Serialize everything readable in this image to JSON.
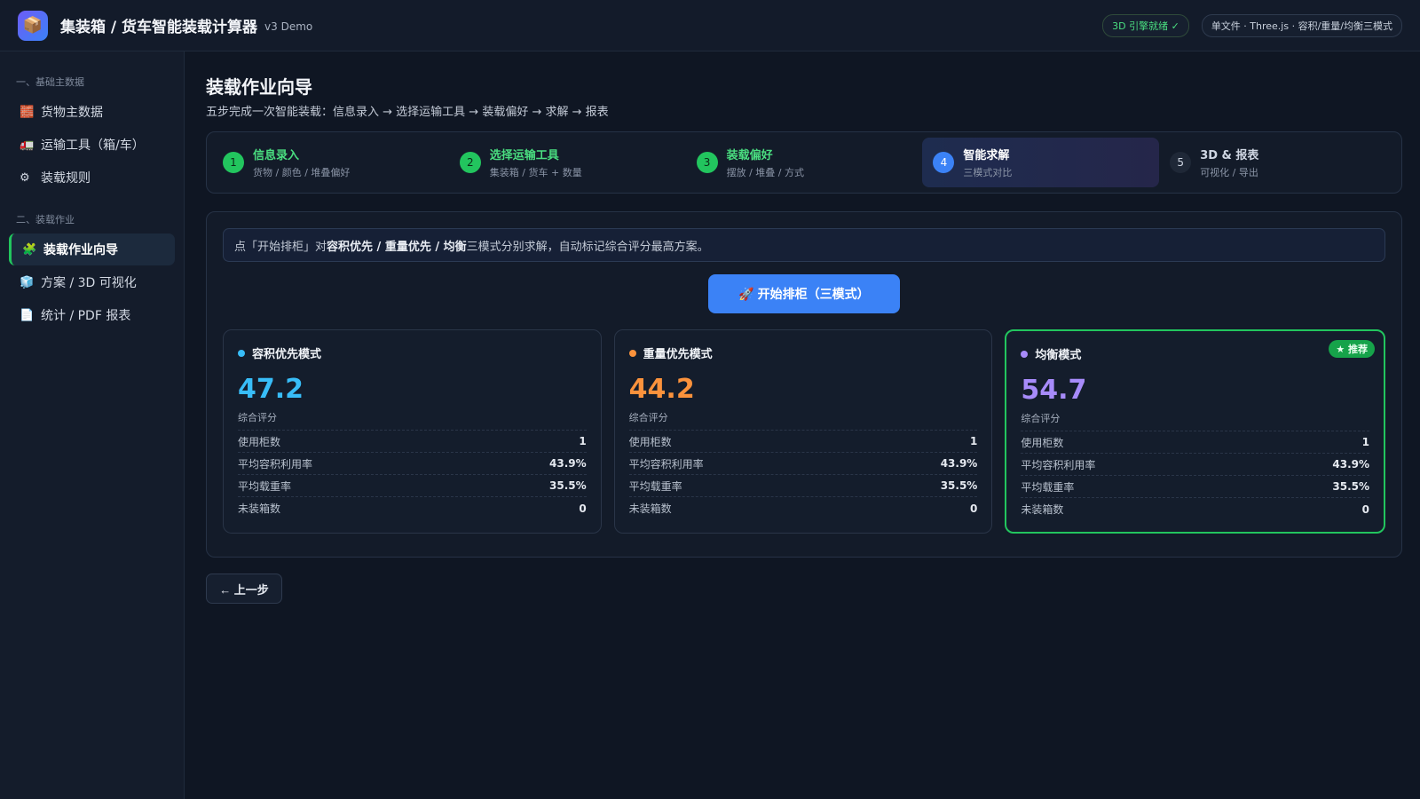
{
  "header": {
    "logo_icon": "package-icon",
    "title": "集装箱 / 货车智能装载计算器",
    "version": "v3 Demo",
    "engine_status": "3D 引擎就绪 ✓",
    "info": "单文件 · Three.js · 容积/重量/均衡三模式"
  },
  "sidebar": {
    "sections": [
      {
        "title": "一、基础主数据",
        "items": [
          {
            "label": "货物主数据",
            "icon": "bricks-icon",
            "glyph": "🧱"
          },
          {
            "label": "运输工具（箱/车）",
            "icon": "truck-icon",
            "glyph": "🚛"
          },
          {
            "label": "装载规则",
            "icon": "gear-icon",
            "glyph": "⚙"
          }
        ]
      },
      {
        "title": "二、装载作业",
        "items": [
          {
            "label": "装载作业向导",
            "icon": "puzzle-icon",
            "glyph": "🧩",
            "active": true
          },
          {
            "label": "方案 / 3D 可视化",
            "icon": "cube-icon",
            "glyph": "🧊"
          },
          {
            "label": "统计 / PDF 报表",
            "icon": "document-icon",
            "glyph": "📄"
          }
        ]
      }
    ]
  },
  "main": {
    "title": "装载作业向导",
    "subtitle": "五步完成一次智能装载：信息录入 → 选择运输工具 → 装载偏好 → 求解 → 报表",
    "steps": [
      {
        "num": "1",
        "title": "信息录入",
        "desc": "货物 / 颜色 / 堆叠偏好",
        "state": "done"
      },
      {
        "num": "2",
        "title": "选择运输工具",
        "desc": "集装箱 / 货车 + 数量",
        "state": "done"
      },
      {
        "num": "3",
        "title": "装载偏好",
        "desc": "摆放 / 堆叠 / 方式",
        "state": "done"
      },
      {
        "num": "4",
        "title": "智能求解",
        "desc": "三模式对比",
        "state": "cur"
      },
      {
        "num": "5",
        "title": "3D & 报表",
        "desc": "可视化 / 导出",
        "state": "todo"
      }
    ],
    "hint": {
      "prefix": "点「开始排柜」对 ",
      "modes": "容积优先 / 重量优先 / 均衡",
      "suffix": " 三模式分别求解，自动标记综合评分最高方案。"
    },
    "run_button": "🚀 开始排柜（三模式）",
    "back_button": "← 上一步",
    "results": [
      {
        "name": "容积优先模式",
        "color": "#38bdf8",
        "score": "47.2",
        "score_label": "综合评分",
        "recommended": false,
        "metrics": [
          {
            "label": "使用柜数",
            "value": "1"
          },
          {
            "label": "平均容积利用率",
            "value": "43.9%"
          },
          {
            "label": "平均载重率",
            "value": "35.5%"
          },
          {
            "label": "未装箱数",
            "value": "0"
          }
        ]
      },
      {
        "name": "重量优先模式",
        "color": "#fb923c",
        "score": "44.2",
        "score_label": "综合评分",
        "recommended": false,
        "metrics": [
          {
            "label": "使用柜数",
            "value": "1"
          },
          {
            "label": "平均容积利用率",
            "value": "43.9%"
          },
          {
            "label": "平均载重率",
            "value": "35.5%"
          },
          {
            "label": "未装箱数",
            "value": "0"
          }
        ]
      },
      {
        "name": "均衡模式",
        "color": "#a78bfa",
        "score": "54.7",
        "score_label": "综合评分",
        "recommended": true,
        "badge": "★ 推荐",
        "metrics": [
          {
            "label": "使用柜数",
            "value": "1"
          },
          {
            "label": "平均容积利用率",
            "value": "43.9%"
          },
          {
            "label": "平均载重率",
            "value": "35.5%"
          },
          {
            "label": "未装箱数",
            "value": "0"
          }
        ]
      }
    ]
  }
}
